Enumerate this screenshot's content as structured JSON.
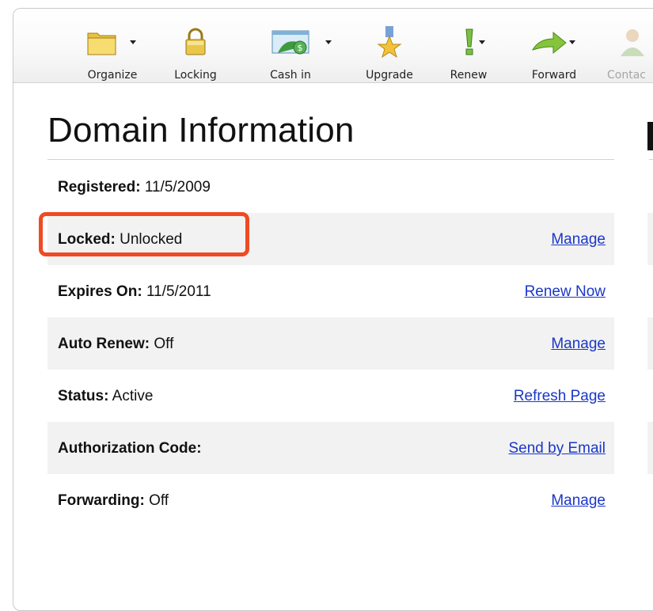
{
  "toolbar": {
    "items": [
      {
        "label": "Organize",
        "icon": "folder-icon",
        "has_dropdown": true,
        "enabled": true
      },
      {
        "label": "Locking",
        "icon": "padlock-icon",
        "has_dropdown": false,
        "enabled": true
      },
      {
        "label": "Cash in",
        "icon": "cash-in-icon",
        "has_dropdown": true,
        "enabled": true
      },
      {
        "label": "Upgrade",
        "icon": "star-medal-icon",
        "has_dropdown": false,
        "enabled": true
      },
      {
        "label": "Renew",
        "icon": "exclamation-icon",
        "has_dropdown": true,
        "enabled": true
      },
      {
        "label": "Forward",
        "icon": "green-arrow-icon",
        "has_dropdown": true,
        "enabled": true
      },
      {
        "label": "Contac",
        "icon": "contact-person-icon",
        "has_dropdown": false,
        "enabled": false
      }
    ]
  },
  "section": {
    "title": "Domain Information"
  },
  "rows": [
    {
      "label": "Registered:",
      "value": "11/5/2009",
      "action": "",
      "shaded": false
    },
    {
      "label": "Locked:",
      "value": "Unlocked",
      "action": "Manage",
      "shaded": true
    },
    {
      "label": "Expires On:",
      "value": "11/5/2011",
      "action": "Renew Now",
      "shaded": false
    },
    {
      "label": "Auto Renew:",
      "value": "Off",
      "action": "Manage",
      "shaded": true
    },
    {
      "label": "Status:",
      "value": "Active",
      "action": "Refresh Page",
      "shaded": false
    },
    {
      "label": "Authorization Code:",
      "value": "",
      "action": "Send by Email",
      "shaded": true
    },
    {
      "label": "Forwarding:",
      "value": "Off",
      "action": "Manage",
      "shaded": false
    }
  ],
  "colors": {
    "link": "#1a37c8",
    "highlight": "#ef4a24",
    "row_shade": "#f2f2f2"
  }
}
